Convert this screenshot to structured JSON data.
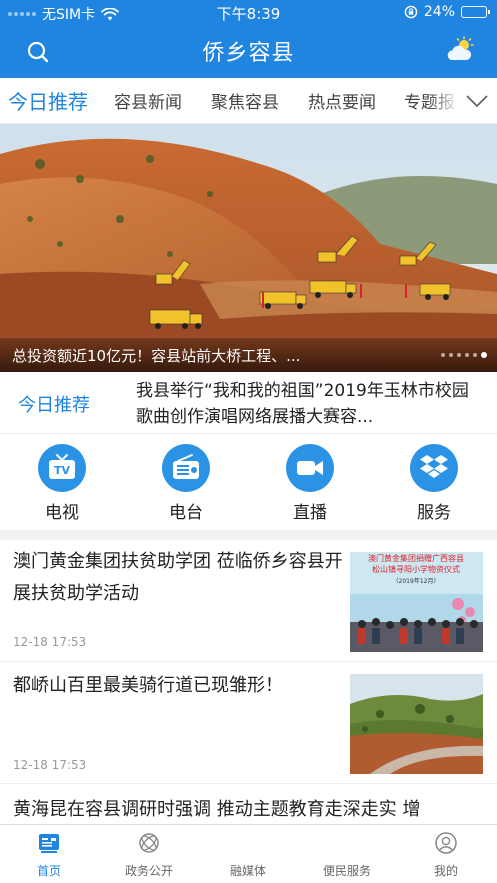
{
  "status_bar": {
    "carrier": "无SIM卡",
    "time": "下午8:39",
    "battery": "24%",
    "battery_level": 0.24
  },
  "header": {
    "title": "侨乡容县",
    "search_icon": "search-icon",
    "weather_icon": "weather-icon"
  },
  "channels": {
    "tabs": [
      "今日推荐",
      "容县新闻",
      "聚焦容县",
      "热点要闻",
      "专题报道"
    ],
    "active": "今日推荐",
    "more_icon": "chevron-down-icon"
  },
  "hero": {
    "caption": "总投资额近10亿元！容县站前大桥工程、...",
    "slides": 6,
    "active_slide": 5
  },
  "recommend": {
    "tag": "今日推荐",
    "headline": "我县举行“我和我的祖国”2019年玉林市校园歌曲创作演唱网络展播大赛容..."
  },
  "quick_links": [
    {
      "label": "电视",
      "icon": "tv-icon"
    },
    {
      "label": "电台",
      "icon": "radio-icon"
    },
    {
      "label": "直播",
      "icon": "video-camera-icon"
    },
    {
      "label": "服务",
      "icon": "dropbox-icon"
    }
  ],
  "news": [
    {
      "title": "澳门黄金集团扶贫助学团 莅临侨乡容县开展扶贫助学活动",
      "time": "12-18 17:53",
      "thumb_text": [
        "澳门黄金集团捐赠广西容县",
        "松山镇寻阳小学物资仪式",
        "（2019年12月）"
      ]
    },
    {
      "title": "都峤山百里最美骑行道已现雏形！",
      "time": "12-18 17:53"
    },
    {
      "title": "黄海昆在容县调研时强调 推动主题教育走深走实 增"
    }
  ],
  "tabbar": [
    {
      "label": "首页",
      "icon": "home-icon",
      "active": true
    },
    {
      "label": "政务公开",
      "icon": "government-icon",
      "active": false
    },
    {
      "label": "融媒体",
      "icon": "media-icon",
      "active": false
    },
    {
      "label": "便民服务",
      "icon": "service-icon",
      "active": false
    },
    {
      "label": "我的",
      "icon": "profile-icon",
      "active": false
    }
  ],
  "colors": {
    "brand_blue": "#1f85e0",
    "text": "#222222",
    "muted": "#999999"
  }
}
